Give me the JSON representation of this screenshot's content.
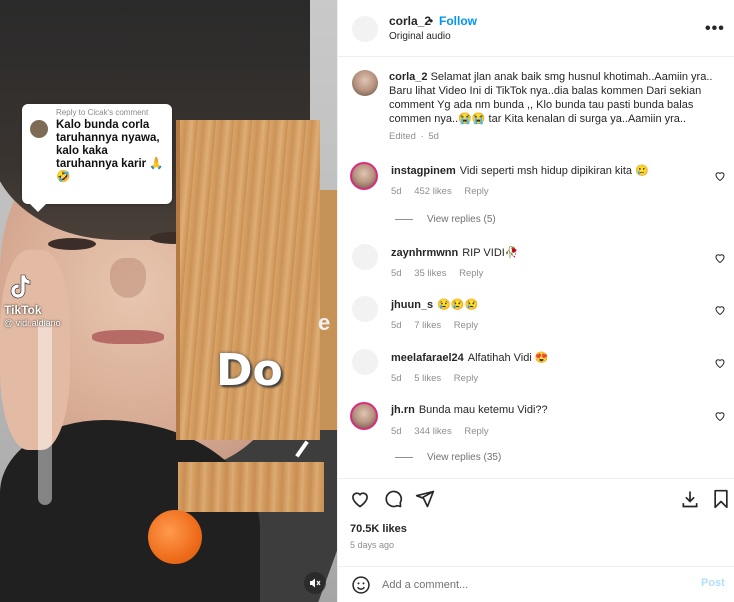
{
  "video": {
    "reply_header": "Reply to Cicak's comment",
    "reply_text": "Kalo bunda corla taruhannya nyawa, kalo kaka taruhannya karir 🙏🤣",
    "tiktok_label": "TikTok",
    "tiktok_handle": "@ vidi.aldiano",
    "overlay_word": "Do",
    "overlay_letter": "e"
  },
  "header": {
    "username": "corla_2",
    "dot": "•",
    "follow_label": "Follow",
    "audio": "Original audio",
    "more_label": "•••"
  },
  "caption": {
    "username": "corla_2",
    "text": "Selamat jlan anak baik smg husnul khotimah..Aamiin yra.. Baru lihat Video Ini di TikTok nya..dia balas kommen Dari sekian comment Yg ada nm bunda ,, Klo bunda tau pasti bunda balas commen nya..😭😭 tar Kita kenalan di surga ya..Aamiin yra..",
    "edited": "Edited",
    "time": "5d"
  },
  "comments": [
    {
      "username": "instagpinem",
      "text": "Vidi seperti msh hidup dipikiran kita 🥲",
      "time": "5d",
      "likes": "452 likes",
      "reply": "Reply",
      "view_replies": "View replies (5)"
    },
    {
      "username": "zaynhrmwnn",
      "text": "RIP VIDI🥀",
      "time": "5d",
      "likes": "35 likes",
      "reply": "Reply"
    },
    {
      "username": "jhuun_s",
      "text": "😢😢😢",
      "time": "5d",
      "likes": "7 likes",
      "reply": "Reply"
    },
    {
      "username": "meelafarael24",
      "text": "Alfatihah Vidi 😍",
      "time": "5d",
      "likes": "5 likes",
      "reply": "Reply"
    },
    {
      "username": "jh.rn",
      "text": "Bunda mau ketemu Vidi??",
      "time": "5d",
      "likes": "344 likes",
      "reply": "Reply",
      "view_replies": "View replies (35)"
    }
  ],
  "actions": {
    "likes": "70.5K likes",
    "ago": "5 days ago"
  },
  "composer": {
    "placeholder": "Add a comment...",
    "post_label": "Post"
  },
  "colors": {
    "accent": "#0095f6",
    "post_disabled": "#b2dffc",
    "text": "#262626",
    "muted": "#8e8e8e"
  }
}
